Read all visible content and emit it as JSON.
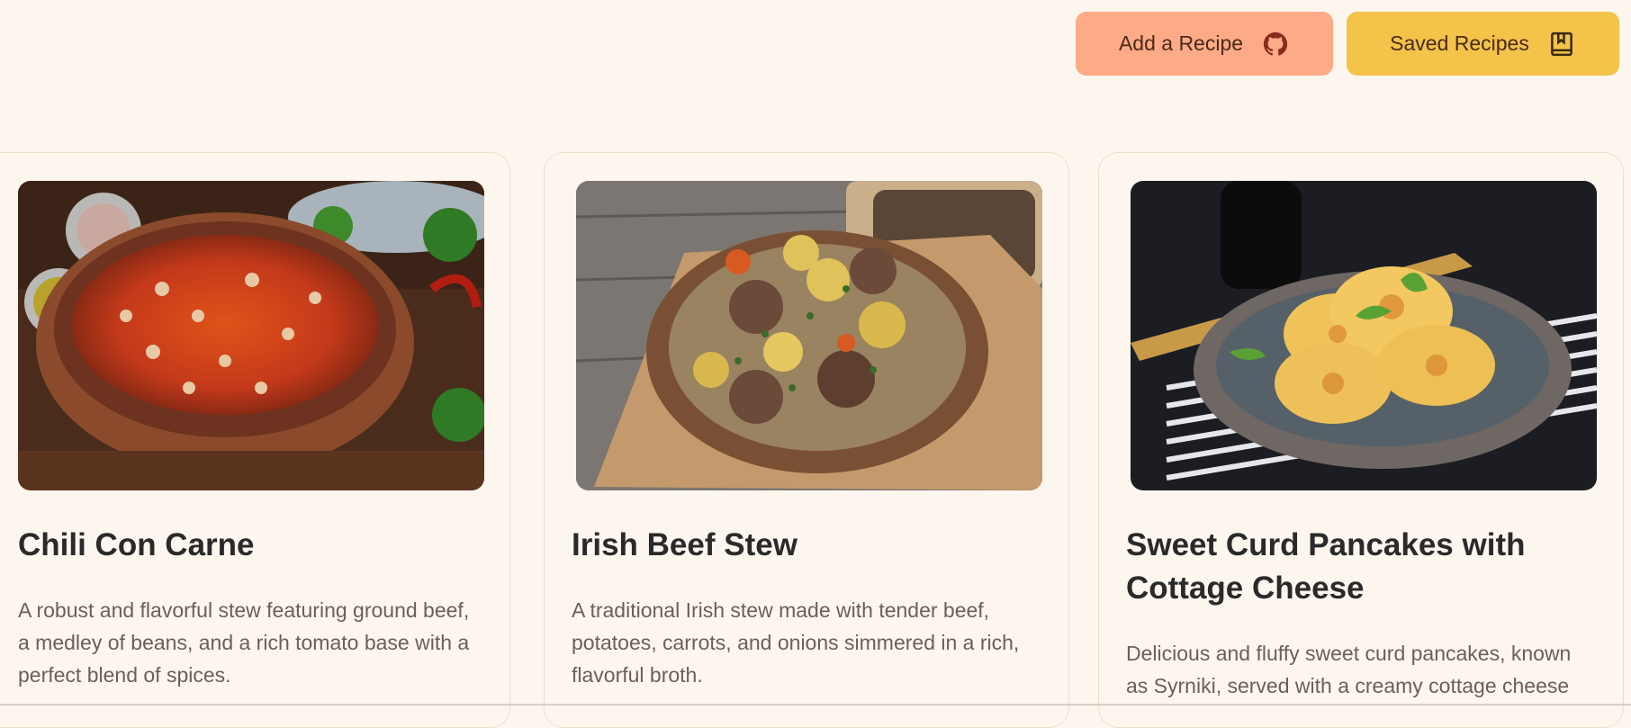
{
  "header": {
    "add_recipe_label": "Add a Recipe",
    "add_recipe_icon": "github-icon",
    "saved_recipes_label": "Saved Recipes",
    "saved_recipes_icon": "bookmark-book-icon",
    "colors": {
      "add_bg": "#fdab86",
      "saved_bg": "#f3c34a",
      "page_bg": "#fdf6ef"
    }
  },
  "recipes": [
    {
      "title": "Chili Con Carne",
      "description": "A robust and flavorful stew featuring ground beef, a medley of beans, and a rich tomato base with a perfect blend of spices.",
      "image": "chili-con-carne-photo"
    },
    {
      "title": "Irish Beef Stew",
      "description": "A traditional Irish stew made with tender beef, potatoes, carrots, and onions simmered in a rich, flavorful broth.",
      "image": "irish-beef-stew-photo"
    },
    {
      "title": "Sweet Curd Pancakes with Cottage Cheese",
      "description": "Delicious and fluffy sweet curd pancakes, known as Syrniki, served with a creamy cottage cheese",
      "image": "sweet-curd-pancakes-photo"
    }
  ]
}
